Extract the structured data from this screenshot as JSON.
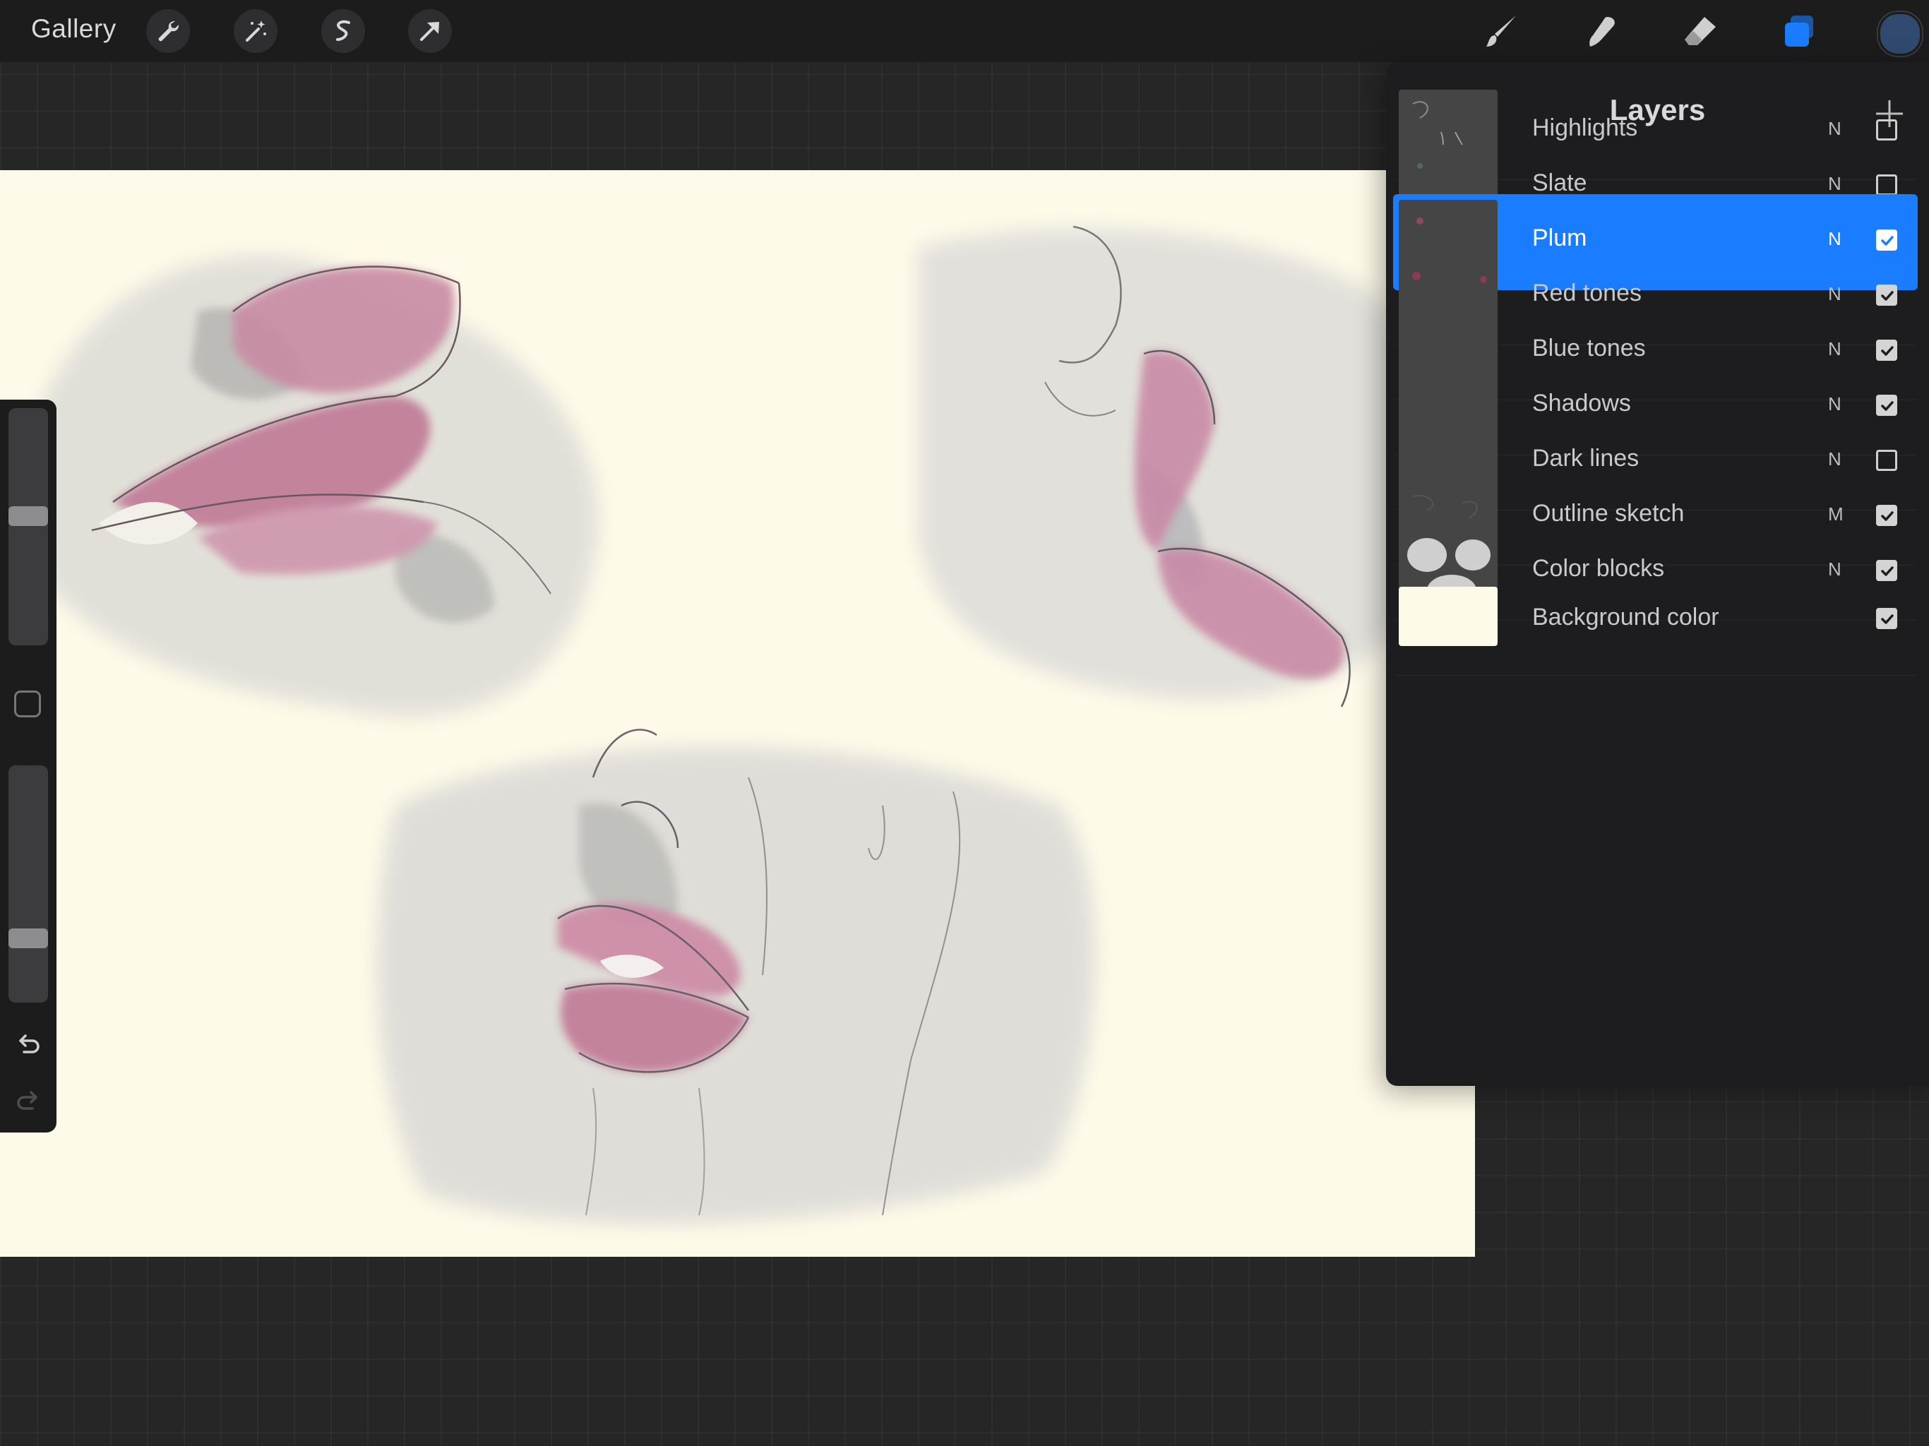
{
  "topbar": {
    "gallery_label": "Gallery",
    "left_tools": [
      "wrench-icon",
      "magic-wand-icon",
      "selection-icon",
      "transform-arrow-icon"
    ],
    "right_tools": [
      "brush-icon",
      "smudge-icon",
      "eraser-icon",
      "layers-icon"
    ],
    "active_color": "#314a70"
  },
  "layers_panel": {
    "title": "Layers",
    "layers": [
      {
        "name": "Highlights",
        "blend": "N",
        "visible": false,
        "selected": false
      },
      {
        "name": "Slate",
        "blend": "N",
        "visible": false,
        "selected": false
      },
      {
        "name": "Plum",
        "blend": "N",
        "visible": true,
        "selected": true
      },
      {
        "name": "Red tones",
        "blend": "N",
        "visible": true,
        "selected": false
      },
      {
        "name": "Blue tones",
        "blend": "N",
        "visible": true,
        "selected": false
      },
      {
        "name": "Shadows",
        "blend": "N",
        "visible": true,
        "selected": false
      },
      {
        "name": "Dark lines",
        "blend": "N",
        "visible": false,
        "selected": false
      },
      {
        "name": "Outline sketch",
        "blend": "M",
        "visible": true,
        "selected": false
      },
      {
        "name": "Color blocks",
        "blend": "N",
        "visible": true,
        "selected": false
      },
      {
        "name": "Background color",
        "blend": "",
        "visible": true,
        "selected": false
      }
    ]
  },
  "sidebar": {
    "brush_size_level": 0.45,
    "opacity_level": 0.75
  },
  "colors": {
    "accent": "#1a7dff",
    "canvas_background": "#fefae9"
  }
}
